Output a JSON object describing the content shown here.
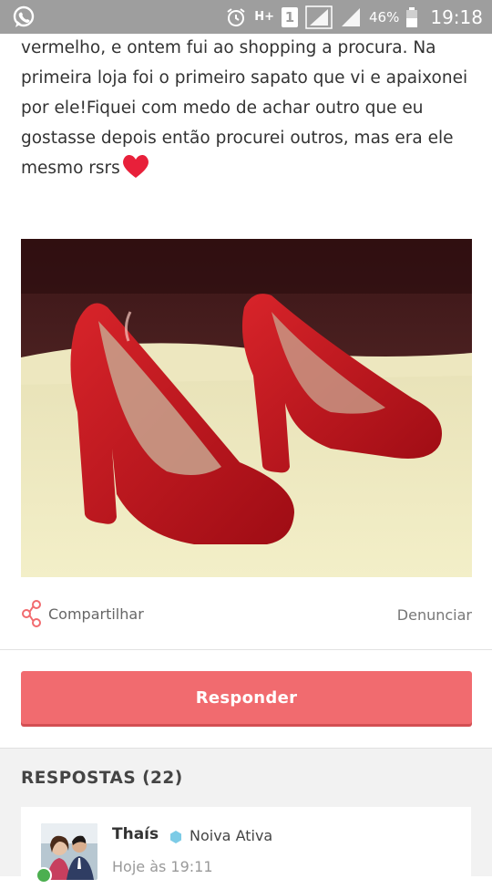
{
  "status_bar": {
    "network": "H+",
    "sim": "1",
    "battery": "46%",
    "time": "19:18",
    "icons": [
      "whatsapp-icon",
      "alarm-icon",
      "signal-icon",
      "battery-icon"
    ]
  },
  "post": {
    "lines": [
      "vermelho, e ontem fui ao shopping a procura. Na",
      "primeira loja foi o primeiro sapato que vi e apaixonei",
      "por ele!Fiquei com medo de achar outro que eu",
      "gostasse depois então procurei outros, mas era ele",
      "mesmo rsrs"
    ],
    "photo_desc": "red-high-heel-shoes-photo"
  },
  "actions": {
    "share_label": "Compartilhar",
    "report_label": "Denunciar"
  },
  "reply_button_label": "Responder",
  "answers": {
    "heading": "RESPOSTAS (22)",
    "items": [
      {
        "author": "Thaís",
        "badge": "Noiva Ativa",
        "time": "Hoje às 19:11"
      }
    ]
  },
  "colors": {
    "accent": "#f16b6f",
    "badge": "#7ccbe6",
    "heart": "#e8203a",
    "status_bar": "#9e9e9e"
  }
}
